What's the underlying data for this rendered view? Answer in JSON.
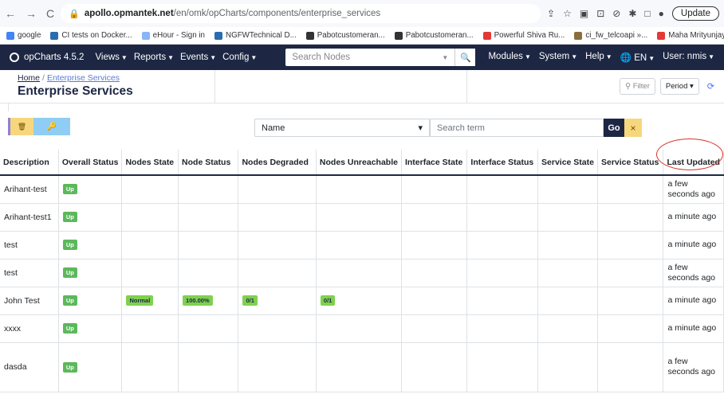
{
  "browser": {
    "url_host": "apollo.opmantek.net",
    "url_path": "/en/omk/opCharts/components/enterprise_services",
    "update_label": "Update"
  },
  "bookmarks": [
    {
      "label": "google",
      "color": "#4285f4"
    },
    {
      "label": "CI tests on Docker...",
      "color": "#2b6cb0"
    },
    {
      "label": "eHour - Sign in",
      "color": "#8ab4f8"
    },
    {
      "label": "NGFWTechnical D...",
      "color": "#2b6cb0"
    },
    {
      "label": "Pabotcustomeran...",
      "color": "#333333"
    },
    {
      "label": "Pabotcustomeran...",
      "color": "#333333"
    },
    {
      "label": "Powerful Shiva Ru...",
      "color": "#e53935"
    },
    {
      "label": "ci_fw_telcoapi »...",
      "color": "#8b6d3f"
    },
    {
      "label": "Maha Mrityunjaya...",
      "color": "#e53935"
    }
  ],
  "navbar": {
    "brand": "opCharts 4.5.2",
    "menu": [
      "Views",
      "Reports",
      "Events",
      "Config"
    ],
    "search_placeholder": "Search Nodes",
    "right_menu": [
      "Modules",
      "System",
      "Help",
      "EN",
      "User: nmis"
    ]
  },
  "page": {
    "crumb_home": "Home",
    "crumb_section": "Enterprise Services",
    "title": "Enterprise Services",
    "filter_label": "Filter",
    "period_label": "Period"
  },
  "toolbar": {
    "select_value": "Name",
    "search_placeholder": "Search term",
    "go_label": "Go",
    "clear_label": "×"
  },
  "table": {
    "headers": [
      "Description",
      "Overall Status",
      "Nodes State",
      "Node Status",
      "Nodes Degraded",
      "Nodes Unreachable",
      "Interface State",
      "Interface Status",
      "Service State",
      "Service Status",
      "Last Updated"
    ],
    "rows": [
      {
        "desc": "Arihant-test",
        "overall": "Up",
        "nodes_state": "",
        "node_status": "",
        "degraded": "",
        "unreachable": "",
        "updated": "a few seconds ago"
      },
      {
        "desc": "Arihant-test1",
        "overall": "Up",
        "nodes_state": "",
        "node_status": "",
        "degraded": "",
        "unreachable": "",
        "updated": "a minute ago"
      },
      {
        "desc": "test",
        "overall": "Up",
        "nodes_state": "",
        "node_status": "",
        "degraded": "",
        "unreachable": "",
        "updated": "a minute ago"
      },
      {
        "desc": "test",
        "overall": "Up",
        "nodes_state": "",
        "node_status": "",
        "degraded": "",
        "unreachable": "",
        "updated": "a few seconds ago"
      },
      {
        "desc": "John Test",
        "overall": "Up",
        "nodes_state": "Normal",
        "node_status": "100.00%",
        "degraded": "0/1",
        "unreachable": "0/1",
        "updated": "a minute ago"
      },
      {
        "desc": "xxxx",
        "overall": "Up",
        "nodes_state": "",
        "node_status": "",
        "degraded": "",
        "unreachable": "",
        "updated": "a minute ago"
      },
      {
        "desc": "dasda",
        "overall": "Up",
        "nodes_state": "",
        "node_status": "",
        "degraded": "",
        "unreachable": "",
        "updated": "a few seconds ago"
      }
    ]
  }
}
